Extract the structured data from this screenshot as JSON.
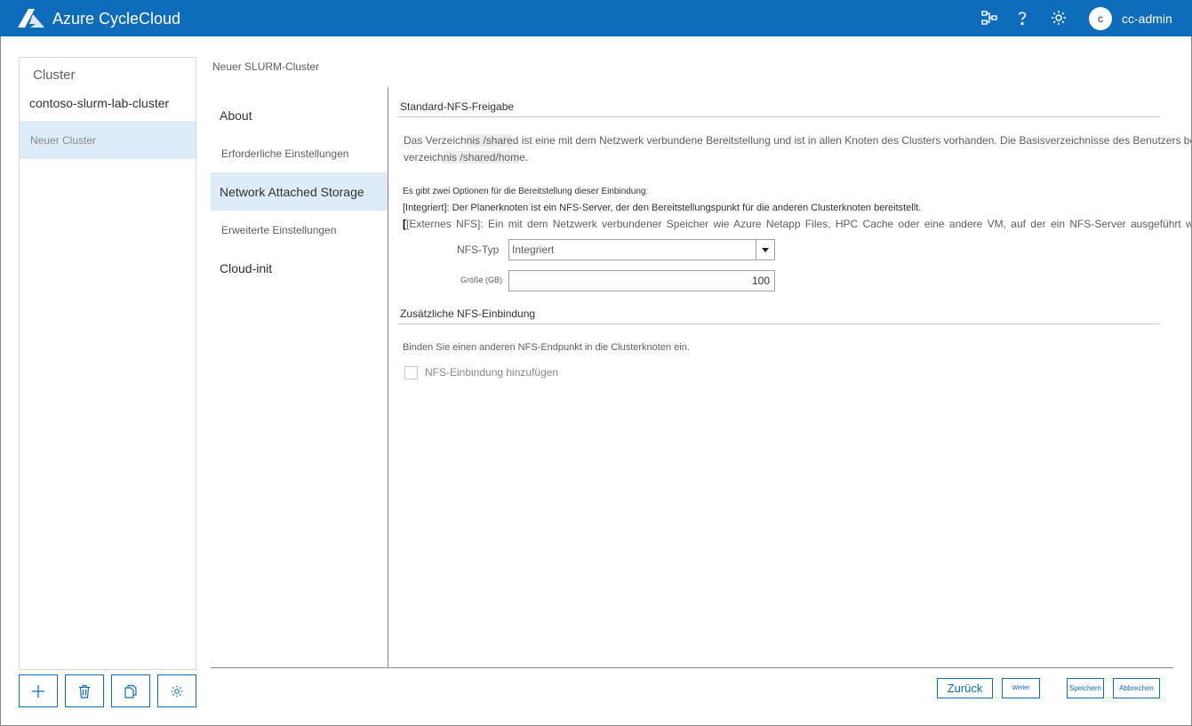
{
  "header": {
    "app_title": "Azure CycleCloud",
    "icons": [
      "node-tree-icon",
      "help-icon",
      "gear-icon"
    ],
    "avatar_initial": "c",
    "username": "cc-admin",
    "bar_color": "#0f6cbd"
  },
  "sidebar": {
    "heading": "Cluster",
    "clusters": [
      {
        "label": "contoso-slurm-lab-cluster",
        "selected": false
      },
      {
        "label": "Neuer Cluster",
        "selected": true
      }
    ],
    "toolbar_icons": [
      "add-icon",
      "delete-icon",
      "copy-icon",
      "settings-icon"
    ]
  },
  "page": {
    "title": "Neuer SLURM-Cluster"
  },
  "nav": {
    "items": [
      {
        "label": "About",
        "active": false
      },
      {
        "label": "Erforderliche Einstellungen",
        "active": false
      },
      {
        "label": "Network Attached Storage",
        "active": true
      },
      {
        "label": "Erweiterte Einstellungen",
        "active": false
      },
      {
        "label": "Cloud-init",
        "active": false
      }
    ]
  },
  "content": {
    "default_nfs": {
      "title": "Standard-NFS-Freigabe",
      "desc_line1_a": "Das Verzeich",
      "desc_line1_hl": "nis /share",
      "desc_line1_b": "d ist eine mit dem Netzwerk verbundene Bereitstellung und ist in allen Knoten des Clusters vorhanden. Die Basisverzeichnisse des Benutzers befinden sich im",
      "desc_line2_a": "verzeich",
      "desc_line2_hl": "nis /shared/hom",
      "desc_line2_b": "e.",
      "options_intro": "Es gibt zwei Optionen für die Bereitstellung dieser Einbindung:",
      "option_integrated": "[Integriert]: Der Planerknoten ist ein NFS-Server, der den Bereitstellungspunkt für die anderen Clusterknoten bereitstellt.",
      "option_external_bracket": "[",
      "option_external": "[Externes NFS]: Ein mit dem Netzwerk verbundener Speicher wie Azure Netapp Files, HPC Cache oder eine andere VM, auf der ein NFS-Server ausgeführt wird",
      "nfs_type_label": "NFS-Typ",
      "nfs_type_value": "Integriert",
      "size_label": "Größe (GB)",
      "size_value": "100"
    },
    "additional_nfs": {
      "title": "Zusätzliche NFS-Einbindung",
      "desc": "Binden Sie einen anderen NFS-Endpunkt in die Clusterknoten ein.",
      "checkbox_label": "NFS-Einbindung hinzufügen",
      "checked": false
    }
  },
  "footer": {
    "back": "Zurück",
    "next": "Weiter",
    "save": "Speichern",
    "cancel": "Abbrechen"
  }
}
